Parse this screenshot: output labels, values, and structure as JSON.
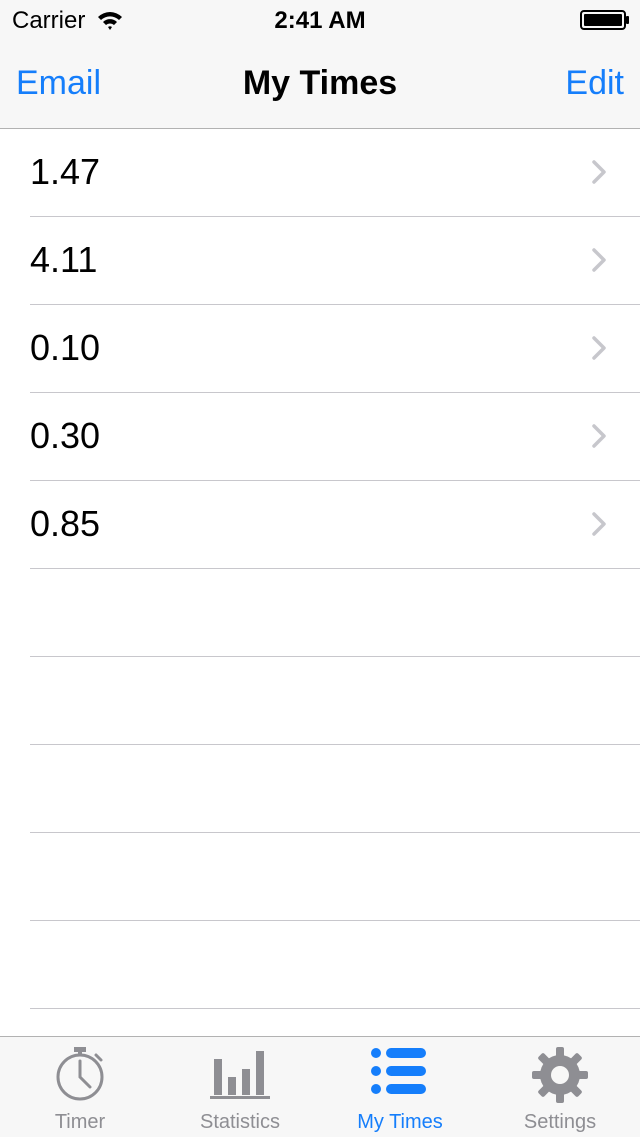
{
  "status": {
    "carrier": "Carrier",
    "time": "2:41 AM"
  },
  "nav": {
    "left_label": "Email",
    "title": "My Times",
    "right_label": "Edit"
  },
  "times": [
    {
      "value": "1.47"
    },
    {
      "value": "4.11"
    },
    {
      "value": "0.10"
    },
    {
      "value": "0.30"
    },
    {
      "value": "0.85"
    }
  ],
  "tabs": [
    {
      "label": "Timer",
      "icon": "stopwatch-icon",
      "active": false
    },
    {
      "label": "Statistics",
      "icon": "bar-chart-icon",
      "active": false
    },
    {
      "label": "My Times",
      "icon": "list-icon",
      "active": true
    },
    {
      "label": "Settings",
      "icon": "gear-icon",
      "active": false
    }
  ],
  "colors": {
    "accent": "#157efb",
    "inactive": "#8e8e93",
    "bar_background": "#f7f7f7",
    "separator": "#c8c7cc"
  }
}
